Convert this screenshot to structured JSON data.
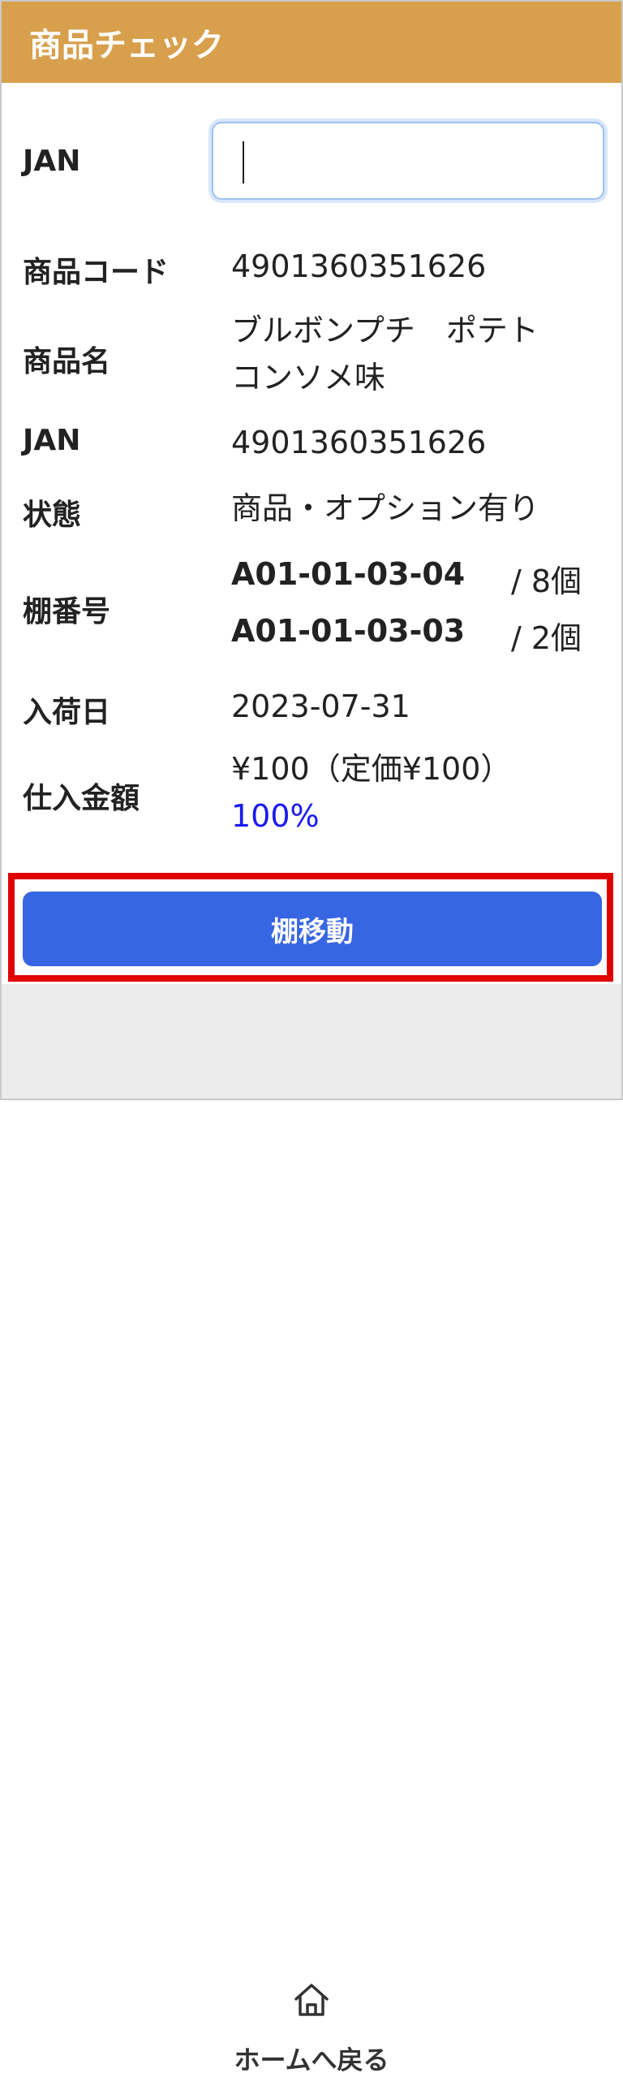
{
  "header": {
    "title": "商品チェック"
  },
  "jan_input": {
    "label": "JAN",
    "value": ""
  },
  "details": {
    "product_code_label": "商品コード",
    "product_code": "4901360351626",
    "product_name_label": "商品名",
    "product_name_line1": "ブルボンプチ　ポテト",
    "product_name_line2": "コンソメ味",
    "jan_label": "JAN",
    "jan": "4901360351626",
    "status_label": "状態",
    "status": "商品・オプション有り",
    "shelf_label": "棚番号",
    "shelves": [
      {
        "code": "A01-01-03-04",
        "qty": "/ 8個"
      },
      {
        "code": "A01-01-03-03",
        "qty": "/ 2個"
      }
    ],
    "arrival_label": "入荷日",
    "arrival_date": "2023-07-31",
    "cost_label": "仕入金額",
    "cost": "¥100（定価¥100）",
    "cost_percent": "100%"
  },
  "actions": {
    "move_shelf_label": "棚移動"
  },
  "footer": {
    "home_label": "ホームへ戻る",
    "home_icon": "home-icon"
  },
  "colors": {
    "header_bg": "#d89f4c",
    "button_bg": "#3766e3",
    "highlight": "#e00000",
    "percent": "#1a1aee"
  }
}
